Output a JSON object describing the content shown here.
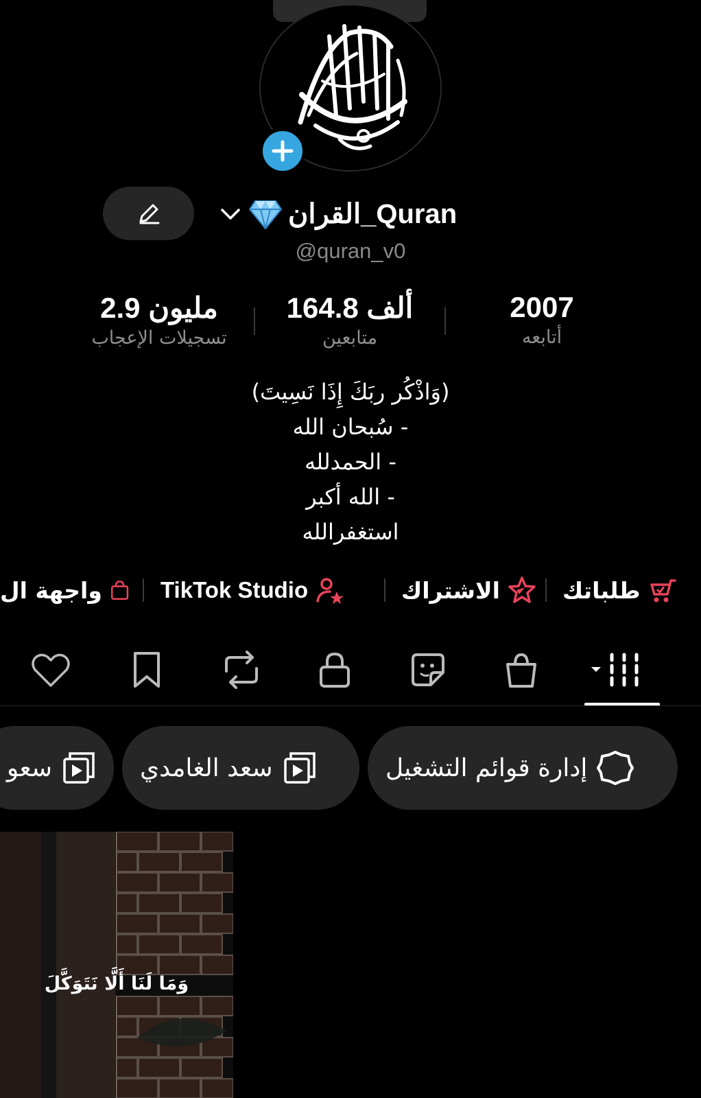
{
  "profile": {
    "avatar_icon": "calligraphy-avatar-icon",
    "avatar_accent": "#36a6e0",
    "display_name": "القران_Quran",
    "badge_icon": "diamond-icon",
    "handle": "@quran_v0",
    "edit_icon": "pencil-icon"
  },
  "stats": [
    {
      "value": "2007",
      "label": "أتابعه"
    },
    {
      "value": "164.8 ألف",
      "label": "متابعين"
    },
    {
      "value": "2.9 مليون",
      "label": "تسجيلات الإعجاب"
    }
  ],
  "bio": {
    "lines": [
      "(وَاذْكُر ربَكَ إِذَا نَسِيتَ)",
      "- سُبحان الله",
      "- الحمدلله",
      "- الله أكبر",
      "استغفرالله"
    ]
  },
  "quick_links": {
    "accent": "#e8435a",
    "items": [
      {
        "label": "طلباتك",
        "icon": "cart-icon"
      },
      {
        "label": "الاشتراك",
        "icon": "star-badge-icon"
      },
      {
        "label": "TikTok Studio",
        "icon": "person-star-icon"
      },
      {
        "label": "واجهة ال",
        "icon": "shopping-bag-icon"
      }
    ]
  },
  "tabs": [
    {
      "name": "videos",
      "icon": "grid-videos-icon",
      "active": true
    },
    {
      "name": "shop",
      "icon": "bag-icon"
    },
    {
      "name": "stickers",
      "icon": "sticker-icon"
    },
    {
      "name": "private",
      "icon": "lock-icon"
    },
    {
      "name": "reposts",
      "icon": "repost-icon"
    },
    {
      "name": "favorites",
      "icon": "bookmark-icon"
    },
    {
      "name": "liked",
      "icon": "heart-icon"
    }
  ],
  "playlists": [
    {
      "label": "إدارة قوائم التشغيل",
      "icon": "gear-icon"
    },
    {
      "label": "سعد الغامدي",
      "icon": "playlist-icon"
    },
    {
      "label": "سعو",
      "icon": "playlist-icon"
    }
  ],
  "videos": [
    {
      "caption": "وَمَا لَنَا أَلَّا نَتَوَكَّلَ"
    }
  ]
}
